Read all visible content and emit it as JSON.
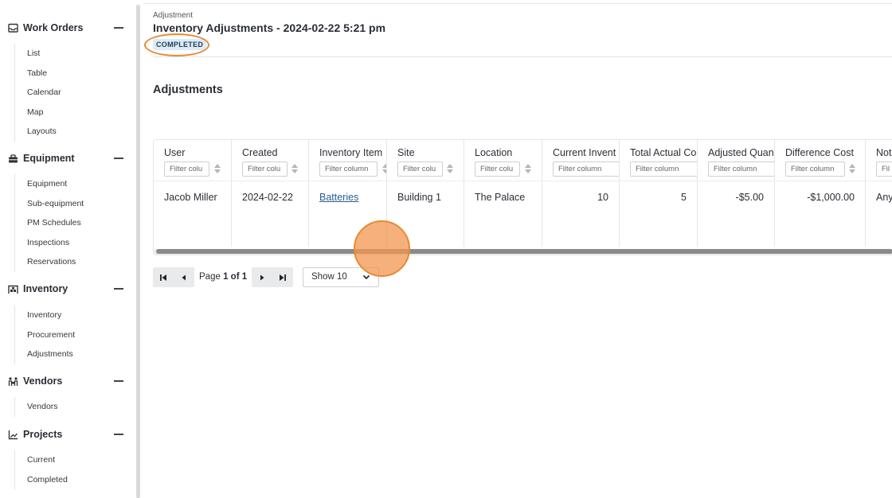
{
  "sidebar": {
    "sections": [
      {
        "title": "Work Orders",
        "icon": "inbox-tray-icon",
        "items": [
          "List",
          "Table",
          "Calendar",
          "Map",
          "Layouts"
        ]
      },
      {
        "title": "Equipment",
        "icon": "toolbox-icon",
        "items": [
          "Equipment",
          "Sub-equipment",
          "PM Schedules",
          "Inspections",
          "Reservations"
        ]
      },
      {
        "title": "Inventory",
        "icon": "warehouse-icon",
        "items": [
          "Inventory",
          "Procurement",
          "Adjustments"
        ]
      },
      {
        "title": "Vendors",
        "icon": "people-carry-icon",
        "items": [
          "Vendors"
        ]
      },
      {
        "title": "Projects",
        "icon": "chart-area-icon",
        "items": [
          "Current",
          "Completed"
        ]
      }
    ]
  },
  "header": {
    "breadcrumb": "Adjustment",
    "title": "Inventory Adjustments - 2024-02-22 5:21 pm",
    "status": "COMPLETED"
  },
  "adjustments": {
    "heading": "Adjustments",
    "columns": [
      {
        "label": "User",
        "filter": "Filter colu"
      },
      {
        "label": "Created",
        "filter": "Filter colu"
      },
      {
        "label": "Inventory Item",
        "filter": "Filter column"
      },
      {
        "label": "Site",
        "filter": "Filter colu"
      },
      {
        "label": "Location",
        "filter": "Filter colu"
      },
      {
        "label": "Current Invent",
        "filter": "Filter column"
      },
      {
        "label": "Total Actual Co",
        "filter": "Filter column"
      },
      {
        "label": "Adjusted Quan",
        "filter": "Filter column"
      },
      {
        "label": "Difference Cost",
        "filter": "Filter column"
      },
      {
        "label": "Not",
        "filter": "Fil"
      }
    ],
    "rows": [
      [
        "Jacob Miller",
        "2024-02-22",
        "Batteries",
        "Building 1",
        "The Palace",
        "10",
        "5",
        "-$5.00",
        "-$1,000.00",
        "Any"
      ]
    ]
  },
  "pagination": {
    "page_label": "Page",
    "page_current": "1",
    "of_label": "of",
    "page_total": "1",
    "show_label": "Show 10"
  },
  "colors": {
    "accent_ring": "#e58b34",
    "badge_bg": "#dcecf7",
    "link": "#2a5d8f"
  }
}
